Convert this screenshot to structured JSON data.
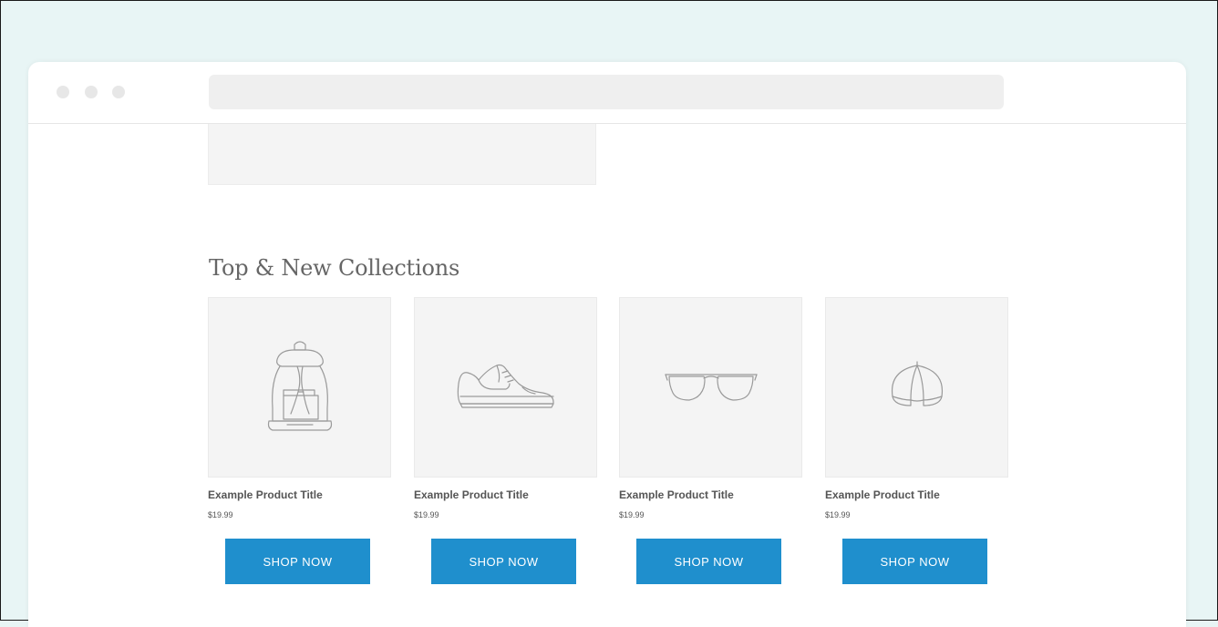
{
  "browser": {
    "address_bar": ""
  },
  "section": {
    "title": "Top & New Collections"
  },
  "products": [
    {
      "icon": "backpack-icon",
      "title": "Example Product Title",
      "price": "$19.99",
      "button": "SHOP NOW"
    },
    {
      "icon": "sneaker-icon",
      "title": "Example Product Title",
      "price": "$19.99",
      "button": "SHOP NOW"
    },
    {
      "icon": "glasses-icon",
      "title": "Example Product Title",
      "price": "$19.99",
      "button": "SHOP NOW"
    },
    {
      "icon": "cap-icon",
      "title": "Example Product Title",
      "price": "$19.99",
      "button": "SHOP NOW"
    }
  ],
  "colors": {
    "background": "#e8f5f5",
    "button": "#1f8fcd",
    "placeholder": "#f4f4f4"
  }
}
